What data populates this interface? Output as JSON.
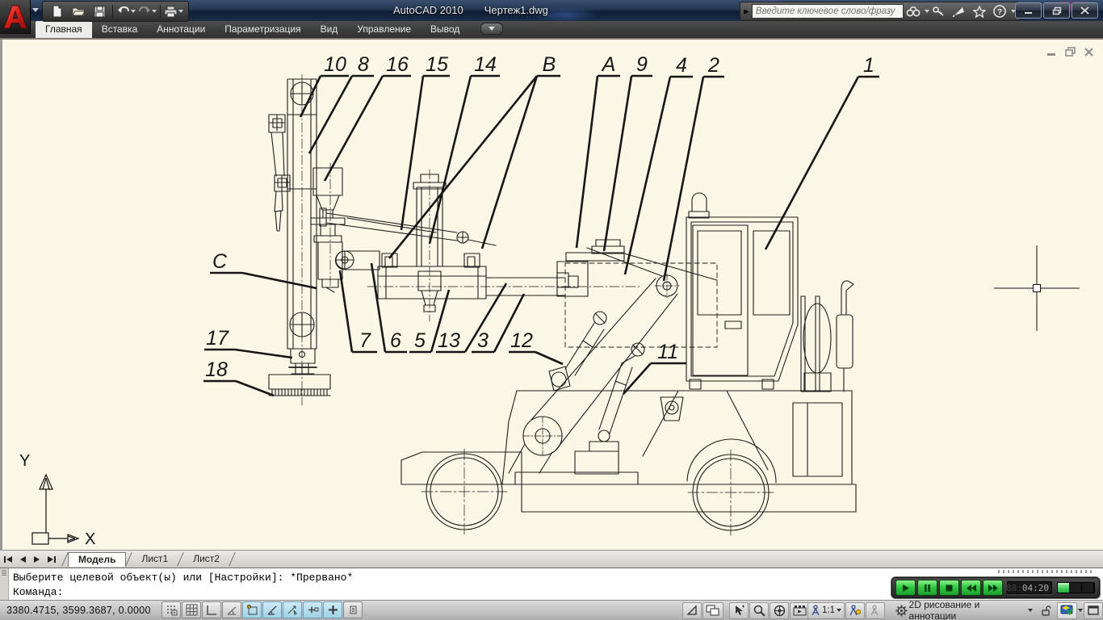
{
  "title_bar": {
    "app_title": "AutoCAD 2010",
    "doc_title": "Чертеж1.dwg",
    "search_placeholder": "Введите ключевое слово/фразу",
    "help_glyph": "?",
    "quick_access_icons": [
      "new-file",
      "open-folder",
      "save-floppy",
      "undo-arrow",
      "redo-arrow",
      "print"
    ],
    "search_icons": [
      "binoculars-search",
      "key",
      "satellite-communication",
      "star-favorites",
      "help-circle"
    ],
    "window_buttons": [
      "minimize",
      "restore",
      "close"
    ]
  },
  "ribbon": {
    "tabs": [
      {
        "label": "Главная",
        "active": true
      },
      {
        "label": "Вставка",
        "active": false
      },
      {
        "label": "Аннотации",
        "active": false
      },
      {
        "label": "Параметризация",
        "active": false
      },
      {
        "label": "Вид",
        "active": false
      },
      {
        "label": "Управление",
        "active": false
      },
      {
        "label": "Вывод",
        "active": false
      }
    ]
  },
  "canvas": {
    "background_color": "#fbf7e6",
    "window_buttons": [
      "minimize",
      "restore",
      "close"
    ],
    "ucs": {
      "x_label": "X",
      "y_label": "Y"
    }
  },
  "drawing": {
    "description": "Side view of a wheeled excavator carrying a vertical drill mast with numbered part callouts",
    "callouts": [
      {
        "label": "10",
        "text": [
          415,
          86
        ],
        "shelf": [
          397,
          92,
          432,
          92
        ],
        "leaders": [
          [
            397,
            92,
            372,
            143
          ]
        ]
      },
      {
        "label": "8",
        "text": [
          450,
          86
        ],
        "shelf": [
          436,
          92,
          463,
          92
        ],
        "leaders": [
          [
            436,
            92,
            383,
            188
          ]
        ]
      },
      {
        "label": "16",
        "text": [
          492,
          86
        ],
        "shelf": [
          474,
          92,
          509,
          92
        ],
        "leaders": [
          [
            474,
            92,
            402,
            222
          ]
        ]
      },
      {
        "label": "15",
        "text": [
          541,
          86
        ],
        "shelf": [
          524,
          92,
          557,
          92
        ],
        "leaders": [
          [
            524,
            92,
            497,
            283
          ]
        ]
      },
      {
        "label": "14",
        "text": [
          601,
          86
        ],
        "shelf": [
          583,
          92,
          619,
          92
        ],
        "leaders": [
          [
            583,
            92,
            532,
            300
          ]
        ]
      },
      {
        "label": "В",
        "text": [
          680,
          86
        ],
        "shelf": [
          665,
          92,
          694,
          92
        ],
        "leaders": [
          [
            665,
            92,
            482,
            318
          ],
          [
            665,
            92,
            597,
            306
          ]
        ]
      },
      {
        "label": "А",
        "text": [
          754,
          86
        ],
        "shelf": [
          740,
          92,
          768,
          92
        ],
        "leaders": [
          [
            740,
            92,
            714,
            305
          ]
        ]
      },
      {
        "label": "9",
        "text": [
          795,
          86
        ],
        "shelf": [
          782,
          92,
          808,
          92
        ],
        "leaders": [
          [
            782,
            92,
            748,
            309
          ]
        ]
      },
      {
        "label": "4",
        "text": [
          844,
          87
        ],
        "shelf": [
          830,
          93,
          858,
          93
        ],
        "leaders": [
          [
            830,
            93,
            774,
            338
          ]
        ]
      },
      {
        "label": "2",
        "text": [
          884,
          87
        ],
        "shelf": [
          871,
          93,
          897,
          93
        ],
        "leaders": [
          [
            871,
            93,
            822,
            346
          ]
        ]
      },
      {
        "label": "1",
        "text": [
          1076,
          87
        ],
        "shelf": [
          1063,
          93,
          1089,
          93
        ],
        "leaders": [
          [
            1063,
            93,
            948,
            307
          ]
        ]
      },
      {
        "label": "С",
        "text": [
          272,
          330
        ],
        "shelf": [
          260,
          336,
          300,
          336
        ],
        "leaders": [
          [
            300,
            336,
            392,
            355
          ]
        ]
      },
      {
        "label": "17",
        "text": [
          269,
          425
        ],
        "shelf": [
          253,
          431,
          291,
          431
        ],
        "leaders": [
          [
            291,
            431,
            362,
            441
          ]
        ]
      },
      {
        "label": "18",
        "text": [
          268,
          464
        ],
        "shelf": [
          252,
          470,
          292,
          470
        ],
        "leaders": [
          [
            292,
            470,
            339,
            488
          ]
        ]
      },
      {
        "label": "7",
        "text": [
          452,
          428
        ],
        "shelf": [
          436,
          434,
          467,
          434
        ],
        "leaders": [
          [
            436,
            434,
            421,
            333
          ]
        ]
      },
      {
        "label": "6",
        "text": [
          490,
          428
        ],
        "shelf": [
          477,
          434,
          504,
          434
        ],
        "leaders": [
          [
            477,
            434,
            460,
            324
          ]
        ]
      },
      {
        "label": "5",
        "text": [
          520,
          428
        ],
        "shelf": [
          507,
          434,
          534,
          434
        ],
        "leaders": [
          [
            534,
            434,
            556,
            357
          ]
        ]
      },
      {
        "label": "13",
        "text": [
          556,
          428
        ],
        "shelf": [
          540,
          434,
          576,
          434
        ],
        "leaders": [
          [
            576,
            434,
            627,
            349
          ]
        ]
      },
      {
        "label": "3",
        "text": [
          598,
          428
        ],
        "shelf": [
          584,
          434,
          612,
          434
        ],
        "leaders": [
          [
            612,
            434,
            649,
            362
          ]
        ]
      },
      {
        "label": "12",
        "text": [
          646,
          428
        ],
        "shelf": [
          630,
          434,
          663,
          434
        ],
        "leaders": [
          [
            663,
            434,
            697,
            449
          ]
        ]
      },
      {
        "label": "11",
        "text": [
          827,
          442
        ],
        "shelf": [
          806,
          448,
          850,
          448
        ],
        "leaders": [
          [
            806,
            448,
            772,
            486
          ]
        ]
      }
    ]
  },
  "layout_tabs": {
    "nav_icons": [
      "first-tab",
      "previous-tab",
      "next-tab",
      "last-tab"
    ],
    "tabs": [
      {
        "label": "Модель",
        "active": true
      },
      {
        "label": "Лист1",
        "active": false
      },
      {
        "label": "Лист2",
        "active": false
      }
    ]
  },
  "command_line": {
    "history_line": "Выберите целевой объект(ы) или [Настройки]: *Прервано*",
    "prompt_line": "Команда:"
  },
  "status_bar": {
    "coordinates": "3380.4715, 3599.3687, 0.0000",
    "toggles": [
      {
        "name": "snap-mode",
        "on": false
      },
      {
        "name": "grid-display",
        "on": false
      },
      {
        "name": "ortho-mode",
        "on": false
      },
      {
        "name": "polar-tracking",
        "on": false
      },
      {
        "name": "object-snap",
        "on": true
      },
      {
        "name": "object-snap-tracking",
        "on": true
      },
      {
        "name": "dynamic-ucs",
        "on": true
      },
      {
        "name": "dynamic-input",
        "on": true
      },
      {
        "name": "lineweight",
        "on": true
      },
      {
        "name": "quick-properties",
        "on": false
      }
    ],
    "annotation_scale": "1:1",
    "workspace_label": "2D рисование и аннотации",
    "right_icons": [
      "model-space",
      "layout-space",
      "quick-view-drawings",
      "zoom",
      "steering-wheel",
      "show-motion",
      "annotation-scale-person",
      "annotation-visibility",
      "auto-annotation",
      "workspace-gear",
      "toolbar-lock",
      "trusted-dwg",
      "clean-screen"
    ]
  },
  "recorder": {
    "buttons": [
      "play",
      "pause",
      "stop",
      "rewind",
      "fast-forward"
    ],
    "ghost_digits": "88:",
    "time": "04:20"
  }
}
